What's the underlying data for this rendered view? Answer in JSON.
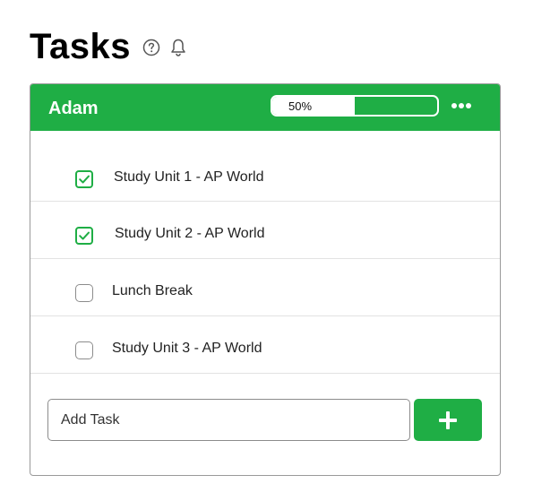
{
  "page": {
    "title": "Tasks",
    "icons": [
      "help-circle-icon",
      "bell-icon"
    ]
  },
  "card": {
    "user_name": "Adam",
    "progress": {
      "label": "50%",
      "value": 0.5
    },
    "menu_icon": "more-horizontal-icon",
    "accent_color": "#1fae45",
    "tasks": [
      {
        "label": "Study Unit 1 - AP World",
        "checked": true
      },
      {
        "label": "Study Unit 2 - AP World",
        "checked": true
      },
      {
        "label": "Lunch Break",
        "checked": false
      },
      {
        "label": "Study Unit 3 - AP World",
        "checked": false
      }
    ],
    "add_task": {
      "placeholder": "Add Task",
      "value": "",
      "button_icon": "plus-icon"
    }
  }
}
